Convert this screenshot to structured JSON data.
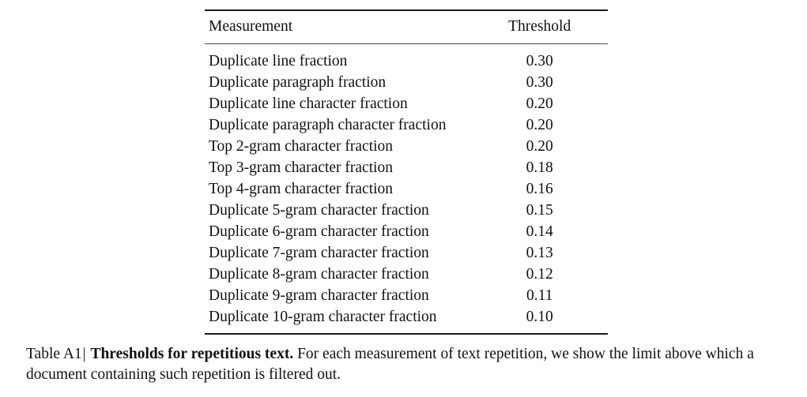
{
  "chart_data": {
    "type": "table",
    "title": "Thresholds for repetitious text",
    "columns": [
      "Measurement",
      "Threshold"
    ],
    "categories": [
      "Duplicate line fraction",
      "Duplicate paragraph fraction",
      "Duplicate line character fraction",
      "Duplicate paragraph character fraction",
      "Top 2-gram character fraction",
      "Top 3-gram character fraction",
      "Top 4-gram character fraction",
      "Duplicate 5-gram character fraction",
      "Duplicate 6-gram character fraction",
      "Duplicate 7-gram character fraction",
      "Duplicate 8-gram character fraction",
      "Duplicate 9-gram character fraction",
      "Duplicate 10-gram character fraction"
    ],
    "values": [
      0.3,
      0.3,
      0.2,
      0.2,
      0.2,
      0.18,
      0.16,
      0.15,
      0.14,
      0.13,
      0.12,
      0.11,
      0.1
    ],
    "xlabel": "Measurement",
    "ylabel": "Threshold"
  },
  "table": {
    "headers": {
      "measurement": "Measurement",
      "threshold": "Threshold"
    },
    "rows": [
      {
        "measurement": "Duplicate line fraction",
        "threshold": "0.30"
      },
      {
        "measurement": "Duplicate paragraph fraction",
        "threshold": "0.30"
      },
      {
        "measurement": "Duplicate line character fraction",
        "threshold": "0.20"
      },
      {
        "measurement": "Duplicate paragraph character fraction",
        "threshold": "0.20"
      },
      {
        "measurement": "Top 2-gram character fraction",
        "threshold": "0.20"
      },
      {
        "measurement": "Top 3-gram character fraction",
        "threshold": "0.18"
      },
      {
        "measurement": "Top 4-gram character fraction",
        "threshold": "0.16"
      },
      {
        "measurement": "Duplicate 5-gram character fraction",
        "threshold": "0.15"
      },
      {
        "measurement": "Duplicate 6-gram character fraction",
        "threshold": "0.14"
      },
      {
        "measurement": "Duplicate 7-gram character fraction",
        "threshold": "0.13"
      },
      {
        "measurement": "Duplicate 8-gram character fraction",
        "threshold": "0.12"
      },
      {
        "measurement": "Duplicate 9-gram character fraction",
        "threshold": "0.11"
      },
      {
        "measurement": "Duplicate 10-gram character fraction",
        "threshold": "0.10"
      }
    ]
  },
  "caption": {
    "label": "Table A1",
    "separator": "|",
    "bold_title": "Thresholds for repetitious text.",
    "body": "For each measurement of text repetition, we show the limit above which a document containing such repetition is filtered out."
  },
  "colors": {
    "text": "#111111",
    "rule_heavy": "#1a1a1a",
    "rule_light": "#4a4a4a",
    "background": "#ffffff"
  }
}
